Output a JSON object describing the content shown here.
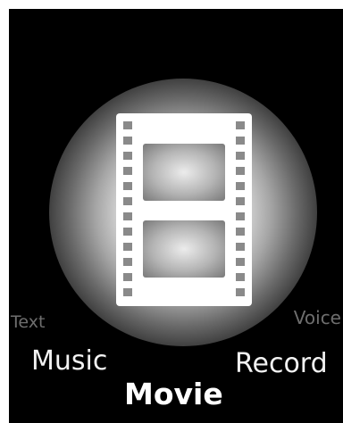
{
  "menu": {
    "selected": "Movie",
    "icon": "film-strip-icon",
    "items": {
      "text": "Text",
      "voice": "Voice",
      "music": "Music",
      "record": "Record",
      "movie": "Movie"
    }
  },
  "colors": {
    "background": "#000000",
    "glow": "#ffffff",
    "active_label": "#ffffff",
    "near_label": "#f2f2f2",
    "far_label": "#6e6e6e"
  }
}
